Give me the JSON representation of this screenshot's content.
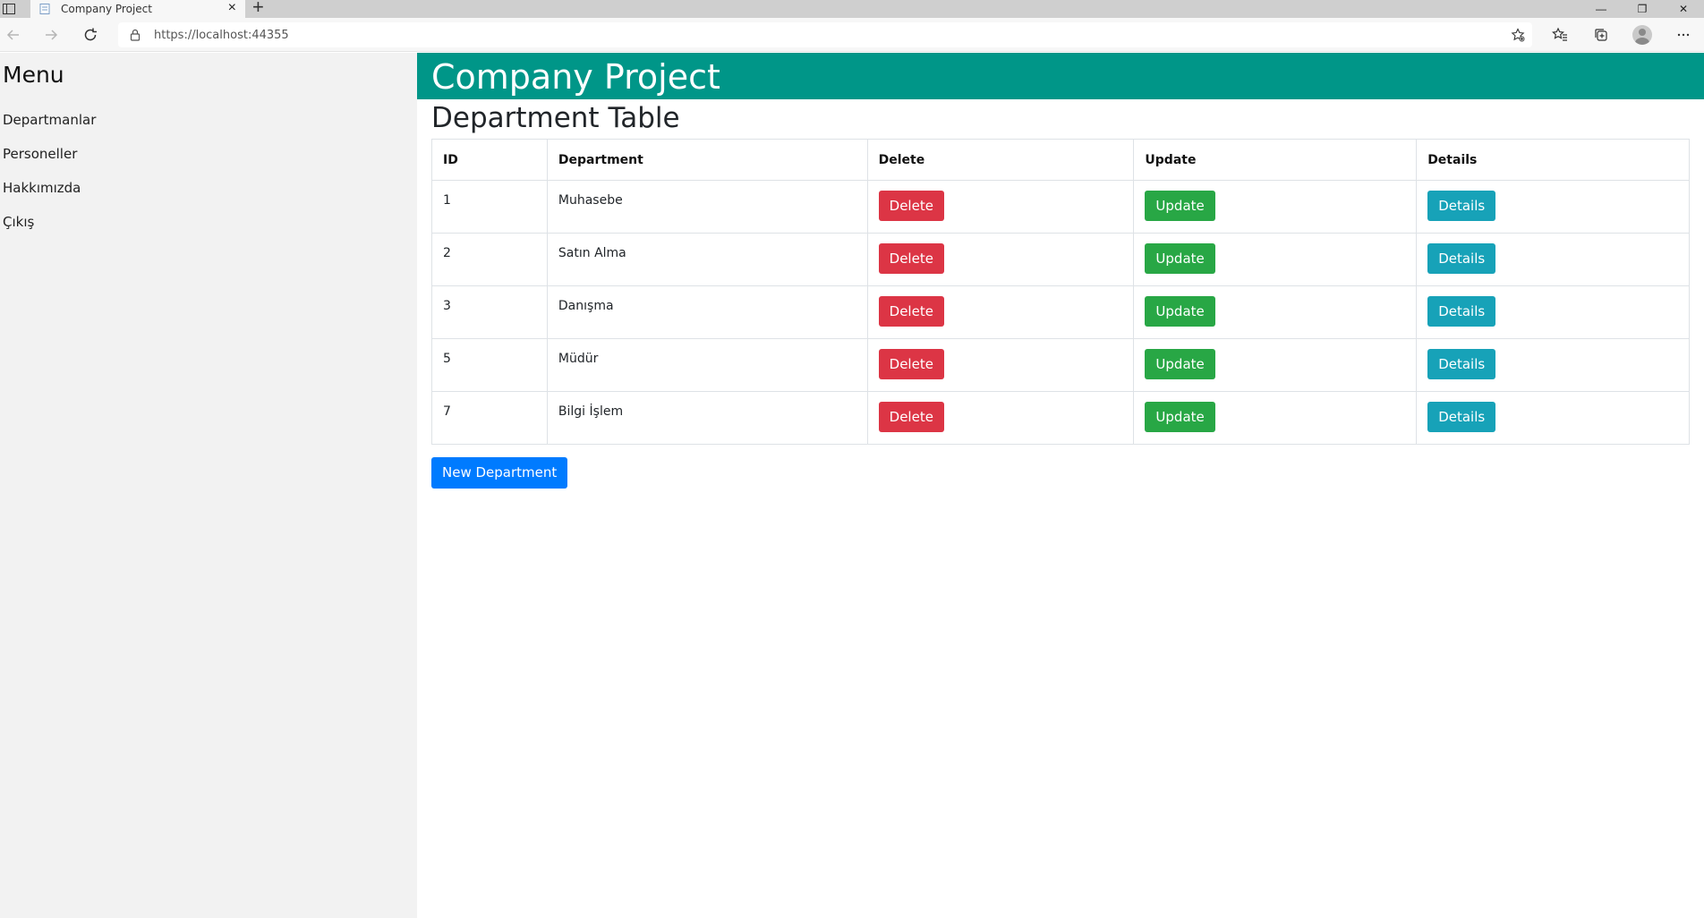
{
  "browser": {
    "tab_title": "Company Project",
    "url": "https://localhost:44355"
  },
  "sidebar": {
    "title": "Menu",
    "items": [
      {
        "label": "Departmanlar"
      },
      {
        "label": "Personeller"
      },
      {
        "label": "Hakkımızda"
      },
      {
        "label": "Çıkış"
      }
    ]
  },
  "header": {
    "app_title": "Company Project",
    "page_title": "Department Table"
  },
  "table": {
    "columns": [
      "ID",
      "Department",
      "Delete",
      "Update",
      "Details"
    ],
    "rows": [
      {
        "id": "1",
        "name": "Muhasebe",
        "delete": "Delete",
        "update": "Update",
        "details": "Details"
      },
      {
        "id": "2",
        "name": "Satın Alma",
        "delete": "Delete",
        "update": "Update",
        "details": "Details"
      },
      {
        "id": "3",
        "name": "Danışma",
        "delete": "Delete",
        "update": "Update",
        "details": "Details"
      },
      {
        "id": "5",
        "name": "Müdür",
        "delete": "Delete",
        "update": "Update",
        "details": "Details"
      },
      {
        "id": "7",
        "name": "Bilgi İşlem",
        "delete": "Delete",
        "update": "Update",
        "details": "Details"
      }
    ]
  },
  "actions": {
    "new_department": "New Department"
  },
  "colors": {
    "header_band": "#009688",
    "delete": "#dc3545",
    "update": "#28a745",
    "details": "#17a2b8",
    "primary": "#007bff"
  }
}
